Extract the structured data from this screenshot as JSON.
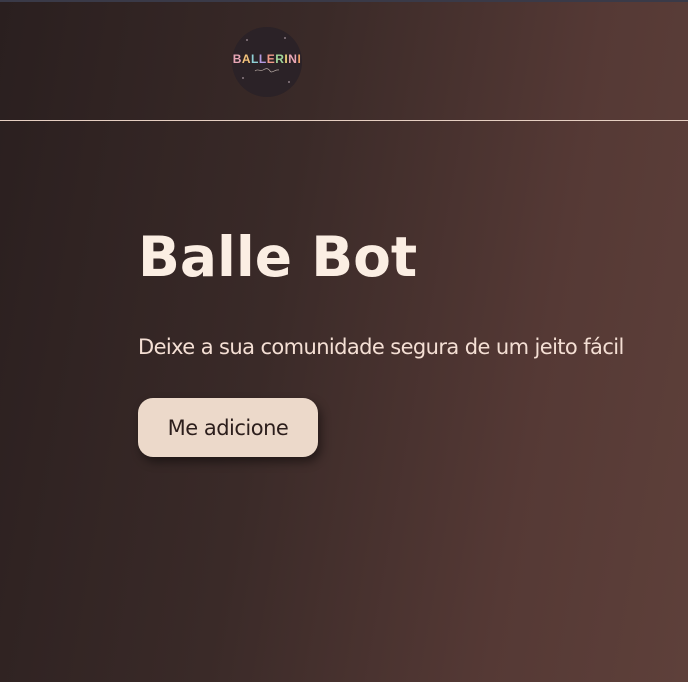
{
  "header": {
    "logo": {
      "letters": [
        {
          "char": "B",
          "color": "#e8a6b5"
        },
        {
          "char": "A",
          "color": "#f2c27a"
        },
        {
          "char": "L",
          "color": "#8fd0d6"
        },
        {
          "char": "L",
          "color": "#b59ae0"
        },
        {
          "char": "E",
          "color": "#f19b8a"
        },
        {
          "char": "R",
          "color": "#9fd59a"
        },
        {
          "char": "I",
          "color": "#f0d37a"
        },
        {
          "char": "N",
          "color": "#e8a6b5"
        },
        {
          "char": "I",
          "color": "#f2a56b"
        }
      ],
      "script": "~signature~"
    }
  },
  "hero": {
    "title": "Balle Bot",
    "subtitle": "Deixe a sua comunidade segura de um jeito fácil",
    "cta_label": "Me adicione"
  },
  "colors": {
    "title": "#fbeee3",
    "button_bg": "#ecd9ca",
    "divider": "#e6cfc2"
  }
}
